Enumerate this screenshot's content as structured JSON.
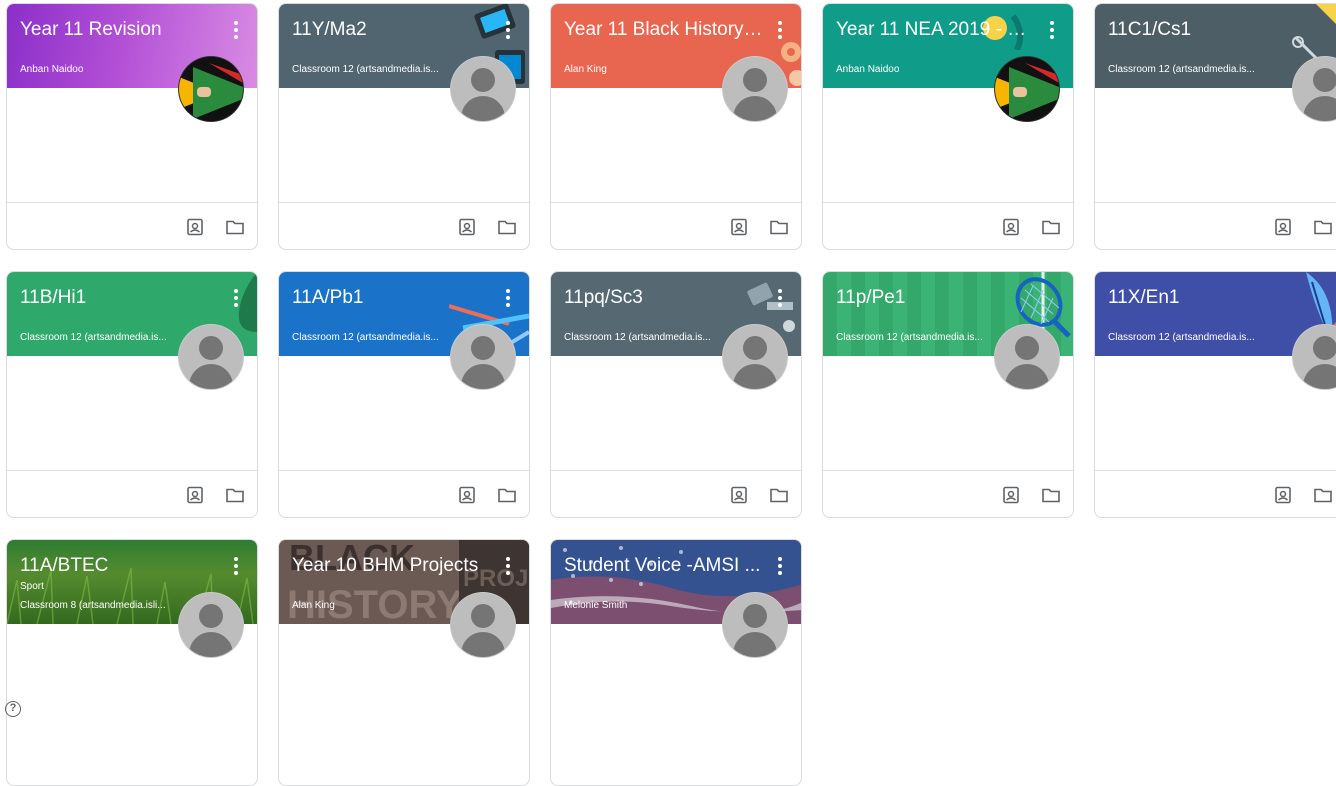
{
  "classes": [
    {
      "title": "Year 11 Revision",
      "subtitle": "",
      "owner": "Anban Naidoo",
      "avatar": "flag-avatar-icon",
      "theme": "#9b3fd0"
    },
    {
      "title": "11Y/Ma2",
      "subtitle": "",
      "owner": "Classroom 12 (artsandmedia.is...",
      "avatar": "default-avatar-icon",
      "theme": "#516570"
    },
    {
      "title": "Year 11 Black History ...",
      "subtitle": "",
      "owner": "Alan King",
      "avatar": "default-avatar-icon",
      "theme": "#e8664f"
    },
    {
      "title": "Year 11 NEA 2019 - 20...",
      "subtitle": "",
      "owner": "Anban Naidoo",
      "avatar": "flag-avatar-icon",
      "theme": "#0f9d8a"
    },
    {
      "title": "11C1/Cs1",
      "subtitle": "",
      "owner": "Classroom 12 (artsandmedia.is...",
      "avatar": "default-avatar-icon",
      "theme": "#4e5e66"
    },
    {
      "title": "11B/Hi1",
      "subtitle": "",
      "owner": "Classroom 12 (artsandmedia.is...",
      "avatar": "default-avatar-icon",
      "theme": "#2fa86b"
    },
    {
      "title": "11A/Pb1",
      "subtitle": "",
      "owner": "Classroom 12 (artsandmedia.is...",
      "avatar": "default-avatar-icon",
      "theme": "#1a73c8"
    },
    {
      "title": "11pq/Sc3",
      "subtitle": "",
      "owner": "Classroom 12 (artsandmedia.is...",
      "avatar": "default-avatar-icon",
      "theme": "#566872"
    },
    {
      "title": "11p/Pe1",
      "subtitle": "",
      "owner": "Classroom 12 (artsandmedia.is...",
      "avatar": "default-avatar-icon",
      "theme": "#34a86a"
    },
    {
      "title": "11X/En1",
      "subtitle": "",
      "owner": "Classroom 12 (artsandmedia.is...",
      "avatar": "default-avatar-icon",
      "theme": "#3f4ea6"
    },
    {
      "title": "11A/BTEC",
      "subtitle": "Sport",
      "owner": "Classroom 8 (artsandmedia.isli...",
      "avatar": "default-avatar-icon",
      "theme": "#3c8a3a"
    },
    {
      "title": "Year 10 BHM Projects",
      "subtitle": "",
      "owner": "Alan King",
      "avatar": "default-avatar-icon",
      "theme": "#6b5148"
    },
    {
      "title": "Student Voice -AMSI ...",
      "subtitle": "",
      "owner": "Melonie Smith",
      "avatar": "default-avatar-icon",
      "theme": "#3a5a9c"
    }
  ],
  "card_icons": {
    "work": "assignment-portrait-icon",
    "folder": "folder-icon",
    "more": "more-vert-icon"
  },
  "banner_art": {
    "bhm_text_1": "BLACK",
    "bhm_text_2": "HISTORY",
    "bhm_text_3": "PROJ"
  },
  "help": {
    "icon": "help-icon",
    "label": "?"
  }
}
